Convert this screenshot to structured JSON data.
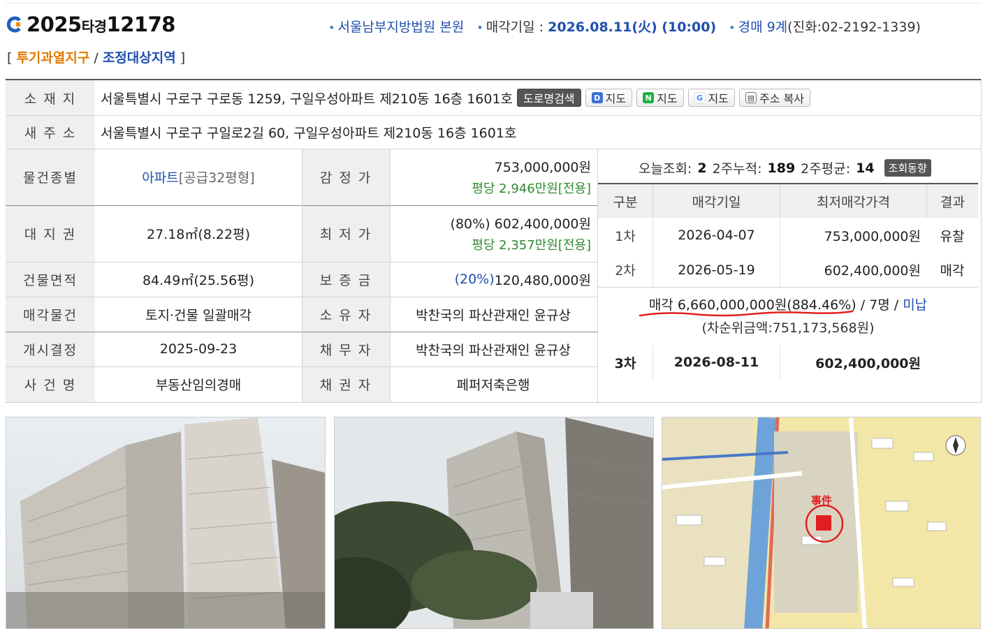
{
  "case": {
    "year": "2025",
    "type": "타경",
    "number": "12178"
  },
  "header": {
    "court": "서울남부지방법원 본원",
    "sale_date_label": "매각기일 : ",
    "sale_date": "2026.08.11(火) (10:00)",
    "dept": "경매 9계",
    "phone": "(진화:02-2192-1339)"
  },
  "tags": {
    "open": "[ ",
    "tag1": "투기과열지구",
    "sep": " / ",
    "tag2": "조정대상지역",
    "close": " ]"
  },
  "address": {
    "label": "소 재 지",
    "value": "서울특별시 구로구 구로동 1259, 구일우성아파트 제210동 16층 1601호",
    "road_btn": "도로명검색",
    "map_d": "지도",
    "map_n": "지도",
    "map_g": "지도",
    "copy": "주소 복사"
  },
  "new_address": {
    "label": "새 주 소",
    "value": "서울특별시 구로구 구일로2길 60, 구일우성아파트 제210동 16층 1601호"
  },
  "info": {
    "type_label": "물건종별",
    "type_value": "아파트",
    "type_sub": "[공급32평형]",
    "appraisal_label": "감 정 가",
    "appraisal_value": "753,000,000원",
    "appraisal_sub": "평당 2,946만원[전용]",
    "land_label": "대 지 권",
    "land_value": "27.18㎡(8.22평)",
    "min_label": "최 저 가",
    "min_value": "(80%) 602,400,000원",
    "min_sub": "평당 2,357만원[전용]",
    "bldg_label": "건물면적",
    "bldg_value": "84.49㎡(25.56평)",
    "deposit_label": "보 증 금",
    "deposit_pct": "(20%)",
    "deposit_value": " 120,480,000원",
    "sale_obj_label": "매각물건",
    "sale_obj_value": "토지·건물 일괄매각",
    "owner_label": "소 유 자",
    "owner_value": "박찬국의 파산관재인 윤규상",
    "start_label": "개시결정",
    "start_value": "2025-09-23",
    "debtor_label": "채 무 자",
    "debtor_value": "박찬국의 파산관재인 윤규상",
    "case_label": "사 건 명",
    "case_value": "부동산임의경매",
    "creditor_label": "채 권 자",
    "creditor_value": "페퍼저축은행"
  },
  "stats": {
    "today_label": "오늘조회:",
    "today": "2",
    "two_week_label": "2주누적:",
    "two_week": "189",
    "avg_label": "2주평균:",
    "avg": "14",
    "trend_btn": "조회동향"
  },
  "history": {
    "headers": [
      "구분",
      "매각기일",
      "최저매각가격",
      "결과"
    ],
    "rows": [
      {
        "round": "1차",
        "date": "2026-04-07",
        "price": "753,000,000원",
        "result": "유찰"
      },
      {
        "round": "2차",
        "date": "2026-05-19",
        "price": "602,400,000원",
        "result": "매각"
      }
    ],
    "sale_result": "매각 6,660,000,000원(884.46%)",
    "bidders": " / 7명 / ",
    "unpaid": "미납",
    "second_bid": "(차순위금액:751,173,568원)",
    "round3": {
      "round": "3차",
      "date": "2026-08-11",
      "price": "602,400,000원"
    }
  },
  "map": {
    "case_label": "事件"
  }
}
